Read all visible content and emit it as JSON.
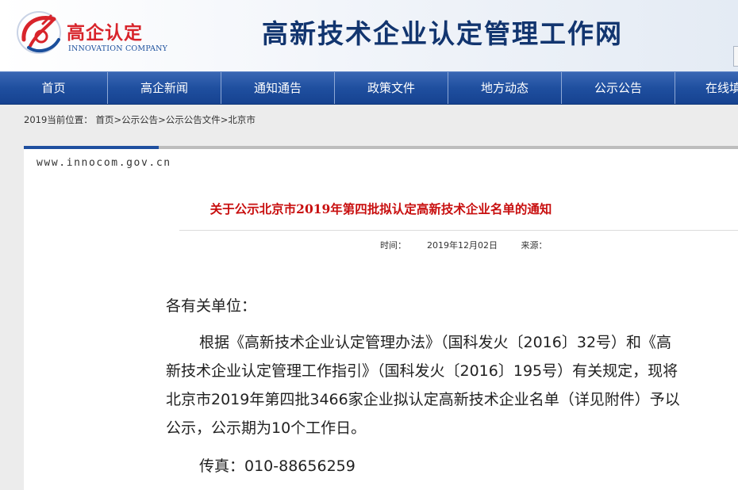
{
  "header": {
    "logo_cn": "高企认定",
    "logo_en": "INNOVATION COMPANY",
    "site_title": "高新技术企业认定管理工作网",
    "brand_red": "#d8242b",
    "brand_blue": "#12356f"
  },
  "nav": {
    "items": [
      "首页",
      "高企新闻",
      "通知通告",
      "政策文件",
      "地方动态",
      "公示公告",
      "在线填"
    ]
  },
  "breadcrumb": {
    "prefix": "2019当前位置：",
    "links": [
      "首页",
      "公示公告",
      "公示公告文件",
      "北京市"
    ],
    "separator": ">"
  },
  "article": {
    "domain": "www.innocom.gov.cn",
    "title": "关于公示北京市2019年第四批拟认定高新技术企业名单的通知",
    "time_label": "时间：",
    "time": "2019年12月02日",
    "source_label": "来源：",
    "source": "",
    "salutation": "各有关单位：",
    "paragraph_lines": [
      "根据《高新技术企业认定管理办法》（国科发火〔2016〕32号）和《高",
      "新技术企业认定管理工作指引》（国科发火〔2016〕195号）有关规定，现将",
      "北京市2019年第四批3466家企业拟认定高新技术企业名单（详见附件）予以",
      "公示，公示期为10个工作日。"
    ],
    "fax": "传真：010-88656259",
    "title_color": "#c80f0f"
  }
}
